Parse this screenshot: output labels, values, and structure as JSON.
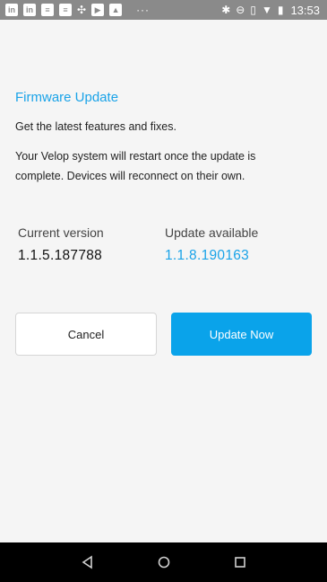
{
  "status_bar": {
    "time": "13:53",
    "left_icons": [
      "linkedin-icon",
      "linkedin-icon",
      "document-icon",
      "document-icon",
      "slack-icon",
      "youtube-icon",
      "image-icon"
    ],
    "overflow": "···",
    "right_icons": [
      "bluetooth-icon",
      "do-not-disturb-icon",
      "vibrate-icon",
      "wifi-icon",
      "battery-icon"
    ]
  },
  "firmware": {
    "title": "Firmware Update",
    "subtitle": "Get the latest features and fixes.",
    "description": "Your Velop system will restart once the update is complete. Devices will reconnect on their own."
  },
  "versions": {
    "current_label": "Current version",
    "current_value": "1.1.5.187788",
    "available_label": "Update available",
    "available_value": "1.1.8.190163"
  },
  "actions": {
    "cancel_label": "Cancel",
    "update_label": "Update Now"
  },
  "colors": {
    "accent": "#1aa3e8",
    "button_primary": "#0aa3ea",
    "status_bar": "#8a8a8a",
    "nav_bar": "#000000"
  }
}
